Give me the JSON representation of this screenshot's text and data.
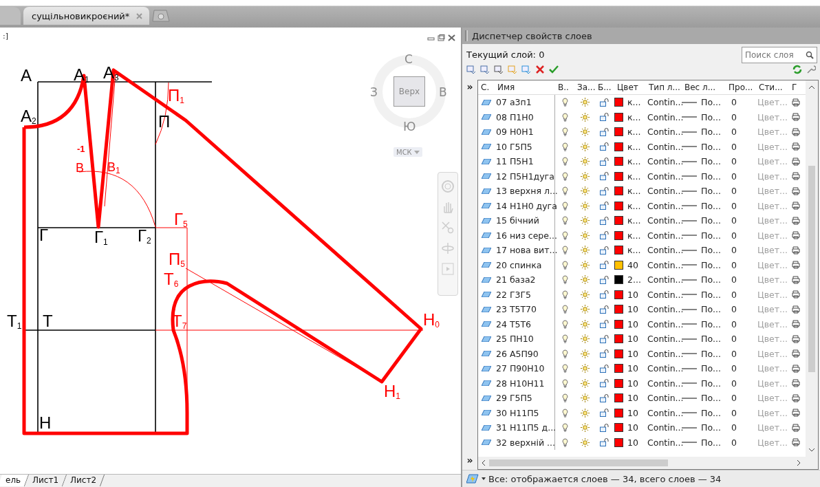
{
  "document_tabs": [
    {
      "label": "сущільновикроєний*",
      "selected": true
    }
  ],
  "viewport": {
    "label": ":]",
    "viewcube": {
      "top": "С",
      "right": "В",
      "bottom": "Ю",
      "left": "З",
      "face": "Верх",
      "ucs": "МСК"
    },
    "labels": [
      {
        "text": "А",
        "color": "#000000"
      },
      {
        "text": "А$_{1}$",
        "color": "#000000"
      },
      {
        "text": "А$_{3}$",
        "color": "#000000"
      },
      {
        "text": "А$_{2}$",
        "color": "#000000"
      },
      {
        "text": "П$_{1}$",
        "color": "#ff0000"
      },
      {
        "text": "П",
        "color": "#000000"
      },
      {
        "text": "-1",
        "color": "#ff0000"
      },
      {
        "text": "В",
        "color": "#ff0000"
      },
      {
        "text": "В$_{1}$",
        "color": "#ff0000"
      },
      {
        "text": "Г",
        "color": "#000000"
      },
      {
        "text": "Г$_{1}$",
        "color": "#000000"
      },
      {
        "text": "Г$_{2}$",
        "color": "#000000"
      },
      {
        "text": "Г$_{5}$",
        "color": "#ff0000"
      },
      {
        "text": "П$_{5}$",
        "color": "#ff0000"
      },
      {
        "text": "Т$_{6}$",
        "color": "#ff0000"
      },
      {
        "text": "Т$_{1}$",
        "color": "#000000"
      },
      {
        "text": "Т",
        "color": "#000000"
      },
      {
        "text": "Т$_{7}$",
        "color": "#ff0000"
      },
      {
        "text": "Н$_{0}$",
        "color": "#ff0000"
      },
      {
        "text": "Н$_{1}$",
        "color": "#ff0000"
      },
      {
        "text": "Н",
        "color": "#000000"
      }
    ],
    "layout_tabs": [
      {
        "label": "ель",
        "selected": true
      },
      {
        "label": "Лист1",
        "selected": false
      },
      {
        "label": "Лист2",
        "selected": false
      }
    ]
  },
  "layers_panel": {
    "title": "Диспетчер свойств слоев",
    "current_layer": "Текущий слой: 0",
    "search": {
      "placeholder": "Поиск слоя"
    },
    "expand_glyphs": [
      "»",
      "»"
    ],
    "columns": [
      "С.",
      "Имя",
      "В..",
      "За...",
      "Б...",
      "Цвет",
      "Тип л...",
      "Вес л...",
      "Про...",
      "Сти...",
      "Г"
    ],
    "rows": [
      {
        "name": "07 а3п1",
        "color": "#ff0000",
        "color_name": "к...",
        "linetype": "Contin...",
        "lineweight": "По...",
        "transparency": "0",
        "plot_style": "Цвет..."
      },
      {
        "name": "08 П1Н0",
        "color": "#ff0000",
        "color_name": "к...",
        "linetype": "Contin...",
        "lineweight": "По...",
        "transparency": "0",
        "plot_style": "Цвет..."
      },
      {
        "name": "09 Н0Н1",
        "color": "#ff0000",
        "color_name": "к...",
        "linetype": "Contin...",
        "lineweight": "По...",
        "transparency": "0",
        "plot_style": "Цвет..."
      },
      {
        "name": "10 Г5П5",
        "color": "#ff0000",
        "color_name": "к...",
        "linetype": "Contin...",
        "lineweight": "По...",
        "transparency": "0",
        "plot_style": "Цвет..."
      },
      {
        "name": "11 П5Н1",
        "color": "#ff0000",
        "color_name": "к...",
        "linetype": "Contin...",
        "lineweight": "По...",
        "transparency": "0",
        "plot_style": "Цвет..."
      },
      {
        "name": "12 П5Н1дуга",
        "color": "#ff0000",
        "color_name": "к...",
        "linetype": "Contin...",
        "lineweight": "По...",
        "transparency": "0",
        "plot_style": "Цвет..."
      },
      {
        "name": "13 верхня л...",
        "color": "#ff0000",
        "color_name": "к...",
        "linetype": "Contin...",
        "lineweight": "По...",
        "transparency": "0",
        "plot_style": "Цвет..."
      },
      {
        "name": "14 Н1Н0 дуга",
        "color": "#ff0000",
        "color_name": "к...",
        "linetype": "Contin...",
        "lineweight": "По...",
        "transparency": "0",
        "plot_style": "Цвет..."
      },
      {
        "name": "15 бічний",
        "color": "#ff0000",
        "color_name": "к...",
        "linetype": "Contin...",
        "lineweight": "По...",
        "transparency": "0",
        "plot_style": "Цвет..."
      },
      {
        "name": "16 низ сере...",
        "color": "#ff0000",
        "color_name": "к...",
        "linetype": "Contin...",
        "lineweight": "По...",
        "transparency": "0",
        "plot_style": "Цвет..."
      },
      {
        "name": "17 нова вит...",
        "color": "#ff0000",
        "color_name": "к...",
        "linetype": "Contin...",
        "lineweight": "По...",
        "transparency": "0",
        "plot_style": "Цвет..."
      },
      {
        "name": "20 спинка",
        "color": "#ffc000",
        "color_name": "40",
        "linetype": "Contin...",
        "lineweight": "По...",
        "transparency": "0",
        "plot_style": "Цвет..."
      },
      {
        "name": "21 база2",
        "color": "#000000",
        "color_name": "2...",
        "linetype": "Contin...",
        "lineweight": "По...",
        "transparency": "0",
        "plot_style": "Цвет..."
      },
      {
        "name": "22 Г3Г5",
        "color": "#ff0000",
        "color_name": "10",
        "linetype": "Contin...",
        "lineweight": "По...",
        "transparency": "0",
        "plot_style": "Цвет..."
      },
      {
        "name": "23 Т5Т70",
        "color": "#ff0000",
        "color_name": "10",
        "linetype": "Contin...",
        "lineweight": "По...",
        "transparency": "0",
        "plot_style": "Цвет..."
      },
      {
        "name": "24 Т5Т6",
        "color": "#ff0000",
        "color_name": "10",
        "linetype": "Contin...",
        "lineweight": "По...",
        "transparency": "0",
        "plot_style": "Цвет..."
      },
      {
        "name": "25 ПН10",
        "color": "#ff0000",
        "color_name": "10",
        "linetype": "Contin...",
        "lineweight": "По...",
        "transparency": "0",
        "plot_style": "Цвет..."
      },
      {
        "name": "26 А5П90",
        "color": "#ff0000",
        "color_name": "10",
        "linetype": "Contin...",
        "lineweight": "По...",
        "transparency": "0",
        "plot_style": "Цвет..."
      },
      {
        "name": "27 П90Н10",
        "color": "#ff0000",
        "color_name": "10",
        "linetype": "Contin...",
        "lineweight": "По...",
        "transparency": "0",
        "plot_style": "Цвет..."
      },
      {
        "name": "28 Н10Н11",
        "color": "#ff0000",
        "color_name": "10",
        "linetype": "Contin...",
        "lineweight": "По...",
        "transparency": "0",
        "plot_style": "Цвет..."
      },
      {
        "name": "29 Г5П5",
        "color": "#ff0000",
        "color_name": "10",
        "linetype": "Contin...",
        "lineweight": "По...",
        "transparency": "0",
        "plot_style": "Цвет..."
      },
      {
        "name": "30 Н11П5",
        "color": "#ff0000",
        "color_name": "10",
        "linetype": "Contin...",
        "lineweight": "По...",
        "transparency": "0",
        "plot_style": "Цвет..."
      },
      {
        "name": "31 Н11П5 д...",
        "color": "#ff0000",
        "color_name": "10",
        "linetype": "Contin...",
        "lineweight": "По...",
        "transparency": "0",
        "plot_style": "Цвет..."
      },
      {
        "name": "32 верхній ...",
        "color": "#ff0000",
        "color_name": "10",
        "linetype": "Contin...",
        "lineweight": "По...",
        "transparency": "0",
        "plot_style": "Цвет..."
      }
    ],
    "status": "Все: отображается слоев — 34, всего слоев — 34"
  }
}
